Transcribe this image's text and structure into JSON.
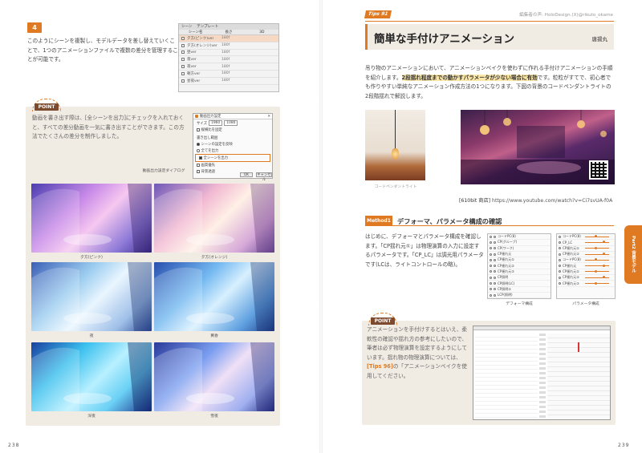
{
  "left": {
    "step_number": "4",
    "intro_text": "このようにシーンを複製し、モデルデータを差し替えていくことで、1つのアニメーションファイルで複数の差分を管理することが可能です。",
    "scene_panel": {
      "tabs": [
        "シーン",
        "テンプレート"
      ],
      "columns": [
        "シーン名",
        "長さ",
        "3D"
      ],
      "rows": [
        {
          "name": "夕方(ピンク)ver",
          "value": "180f",
          "selected": true
        },
        {
          "name": "夕方(オレンジ)ver",
          "value": "180f",
          "selected": false
        },
        {
          "name": "昼ver",
          "value": "180f",
          "selected": false
        },
        {
          "name": "夜ver",
          "value": "180f",
          "selected": false
        },
        {
          "name": "夜ver",
          "value": "180f",
          "selected": false
        },
        {
          "name": "朝方ver",
          "value": "180f",
          "selected": false
        },
        {
          "name": "星夜ver",
          "value": "180f",
          "selected": false
        }
      ]
    },
    "point": {
      "label": "POINT",
      "text": "動画を書き出す際は、[全シーンを出力]にチェックを入れておくと、すべての差分動画を一気に書き出すことができます。この方法でたくさんの差分を制作しました。",
      "dialog": {
        "title": "動画出力設定",
        "size_label": "サイズ",
        "size_w": "1960",
        "size_h": "1080",
        "check_aspect": "縦横比を固定",
        "range_label": "書き出し範囲",
        "radio1": "シーンの設定を反映",
        "radio2": "全てを出力",
        "check_all": "全シーンを出力",
        "check_audio": "画質優先",
        "check_preview": "背景透過",
        "ok": "OK",
        "cancel": "キャンセル"
      },
      "dialog_caption": "動画出力設定ダイアログ",
      "thumbnails": [
        {
          "caption": "夕方(ピンク)"
        },
        {
          "caption": "夕方(オレンジ)"
        },
        {
          "caption": "夜"
        },
        {
          "caption": "黄昏"
        },
        {
          "caption": "深夜"
        },
        {
          "caption": "雪夜"
        }
      ]
    },
    "page_number": "238"
  },
  "right": {
    "tips_label": "Tips 91",
    "byline": "編集者の声: HoloDesign.(X)@rikuto_okame",
    "title": "簡単な手付けアニメーション",
    "author": "唐揚丸",
    "intro_before": "吊り物のアニメーションにおいて、アニメーションベイクを使わずに作れる手付けアニメーションの手順を紹介します。",
    "intro_highlight": "2段揺れ程度までの動かすパラメータが少ない場合に有効",
    "intro_after": "です。粒粒がすてで、初心者でも作りやすい単純なアニメーション作成方法の1つになります。下図の背景のコードペンダントライトの2段階揺れで解説します。",
    "photo_caption": "コードペンダントライト",
    "source_label": "[610bit 商店]",
    "source_url": "https://www.youtube.com/watch?v=Ci7svUA-f0A",
    "method_label": "Method1",
    "method_title": "デフォーマ、パラメータ構成の確認",
    "method_text": "はじめに、デフォーマとパラメータ構成を確認します。「CP揺れ元①」は物理演算の入力に設定するパラメータです。「CP_LC」は調光用パラメータです(LCは、ライトコントロールの略)。",
    "deformer_caption": "デフォーマ構成",
    "param_caption": "パラメータ構成",
    "deformer_rows": [
      "コードPC(8)",
      "CP(グループ)",
      "CP(ワーク)",
      "CP揺れ元",
      "CP揺れ元①",
      "CP揺れ元②",
      "CP揺れ元③",
      "CP照明",
      "CP照明(LC)",
      "CP照明②",
      "LCP(照明)"
    ],
    "param_rows": [
      "コードPC(8)",
      "CP_LC",
      "CP揺れ元①",
      "CP揺れ元②",
      "コードPC(8)",
      "CP揺れ元",
      "CP揺れ元①",
      "CP揺れ元②",
      "CP揺れ元③"
    ],
    "point": {
      "label": "POINT",
      "text_before": "アニメーションを手付けするとはいえ、柔軟性の確認や揺れ方の参考にしたいので、筆者は必ず物理演算を設定するようにしています。揺れ物の物理演算については、",
      "tips_ref": "[Tips 96]",
      "text_after": "の「アニメーションベイクを使用してください。"
    },
    "side_tab": "Part2 背景モデル",
    "page_number": "239"
  }
}
